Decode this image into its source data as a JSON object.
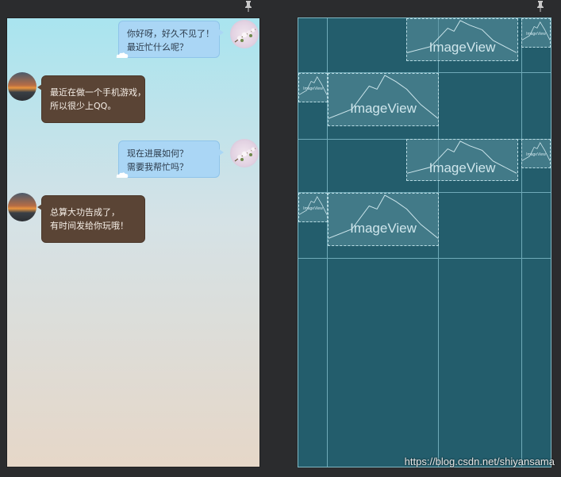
{
  "messages": [
    {
      "side": "right",
      "lines": [
        "你好呀，好久不见了！",
        "最近忙什么呢？"
      ]
    },
    {
      "side": "left",
      "lines": [
        "最近在做一个手机游戏，",
        "所以很少上QQ。"
      ]
    },
    {
      "side": "right",
      "lines": [
        "现在进展如何？",
        "需要我帮忙吗？"
      ]
    },
    {
      "side": "left",
      "lines": [
        "总算大功告成了，",
        "有时间发给你玩哦！"
      ]
    }
  ],
  "blueprint": {
    "view_label": "ImageView"
  },
  "watermark": "https://blog.csdn.net/shiyansama",
  "colors": {
    "blueprint_bg": "#235d6c",
    "blue_bubble": "#aad6f5",
    "brown_bubble": "#5a4435"
  },
  "icons": [
    "pin-icon",
    "flower-avatar",
    "sunset-avatar",
    "mountain-image-placeholder"
  ]
}
